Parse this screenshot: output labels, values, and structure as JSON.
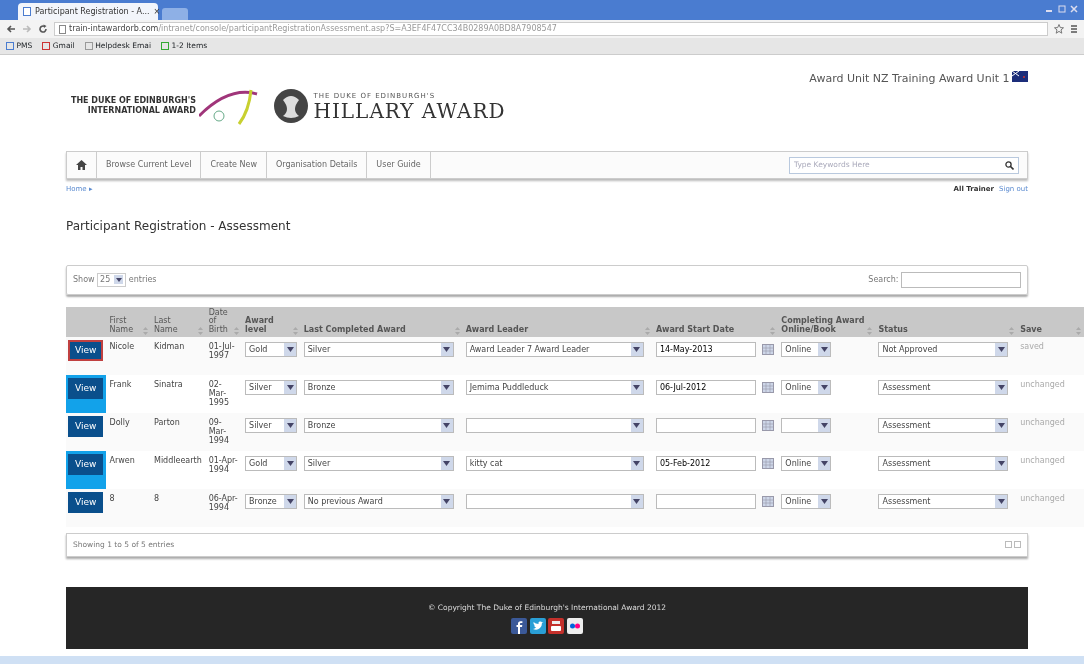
{
  "browser": {
    "tab_title": "Participant Registration - A...",
    "tab_close": "×",
    "url_host": "train-intawardorb.com",
    "url_path": "/intranet/console/participantRegistrationAssessment.asp?S=A3EF4F47CC34B0289A0BD8A7908547",
    "bookmarks": [
      "PMS",
      "Gmail",
      "Helpdesk Emai",
      "1-2 Items"
    ]
  },
  "header": {
    "intl_logo": [
      "THE DUKE OF EDINBURGH'S",
      "INTERNATIONAL AWARD"
    ],
    "hillary_small": "THE DUKE OF EDINBURGH'S",
    "hillary_title": "HILLARY AWARD",
    "unit": "Award Unit NZ Training Award Unit 1"
  },
  "nav": {
    "items": [
      "Browse Current Level",
      "Create New",
      "Organisation Details",
      "User Guide"
    ],
    "search_placeholder": "Type Keywords Here"
  },
  "breadcrumb": "Home ▸",
  "user": "All Trainer",
  "sign_out": "Sign out",
  "title": "Participant Registration - Assessment",
  "table": {
    "show_label": "Show",
    "page_size": "25",
    "entries_label": "entries",
    "search_label": "Search:",
    "columns": [
      "First Name",
      "Last Name",
      "Date of Birth",
      "Award level",
      "Last Completed Award",
      "Award Leader",
      "Award Start Date",
      "Completing Award Online/Book",
      "Status",
      "Save"
    ],
    "rows": [
      {
        "view": "View",
        "selected": true,
        "first": "Nicole",
        "last": "Kidman",
        "dob": "01-Jul-1997",
        "level": "Gold",
        "last_award": "Silver",
        "leader": "Award Leader 7 Award Leader",
        "start": "14-May-2013",
        "completing": "Online",
        "status": "Not Approved",
        "save": "saved"
      },
      {
        "view": "View",
        "selected": false,
        "first": "Frank",
        "last": "Sinatra",
        "dob": "02-Mar-1995",
        "level": "Silver",
        "last_award": "Bronze",
        "leader": "Jemima Puddleduck",
        "start": "06-Jul-2012",
        "completing": "Online",
        "status": "Assessment",
        "save": "unchanged"
      },
      {
        "view": "View",
        "selected": false,
        "first": "Dolly",
        "last": "Parton",
        "dob": "09-Mar-1994",
        "level": "Silver",
        "last_award": "Bronze",
        "leader": "",
        "start": "",
        "completing": "",
        "status": "Assessment",
        "save": "unchanged"
      },
      {
        "view": "View",
        "selected": false,
        "first": "Arwen",
        "last": "Middleearth",
        "dob": "01-Apr-1994",
        "level": "Gold",
        "last_award": "Silver",
        "leader": "kitty cat",
        "start": "05-Feb-2012",
        "completing": "Online",
        "status": "Assessment",
        "save": "unchanged"
      },
      {
        "view": "View",
        "selected": false,
        "first": "8",
        "last": "8",
        "dob": "06-Apr-1994",
        "level": "Bronze",
        "last_award": "No previous Award",
        "leader": "",
        "start": "",
        "completing": "Online",
        "status": "Assessment",
        "save": "unchanged"
      }
    ],
    "info": "Showing 1 to 5 of 5 entries"
  },
  "footer": {
    "prefix": "© Copyright",
    "link": "The Duke of Edinburgh's International Award",
    "year": "2012"
  }
}
